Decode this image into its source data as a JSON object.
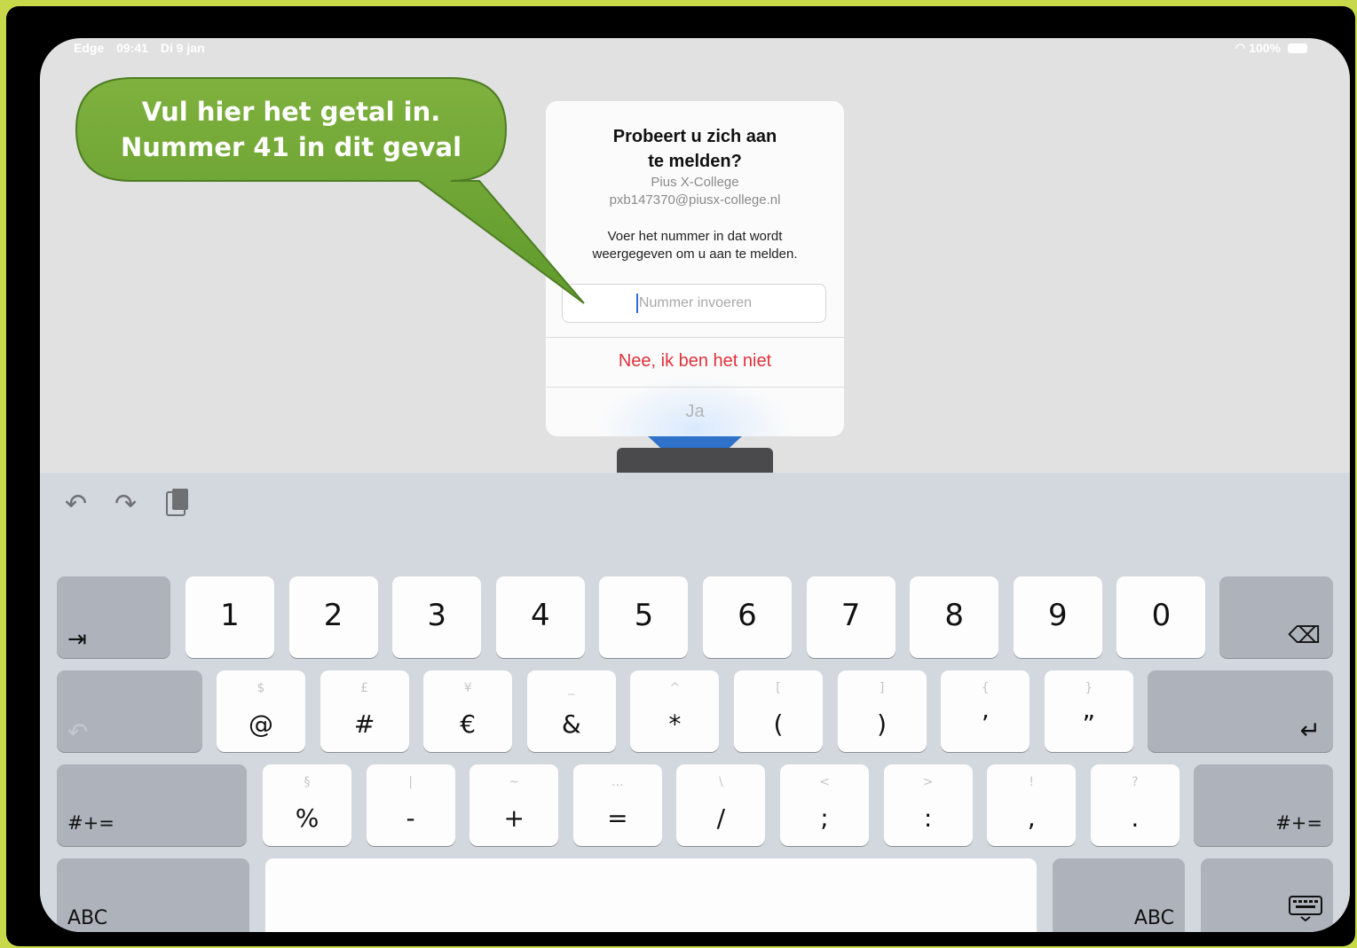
{
  "status": {
    "app": "Edge",
    "time": "09:41",
    "date": "Di 9 jan",
    "battery": "100%"
  },
  "callout": {
    "line1": "Vul hier het getal in.",
    "line2": "Nummer 41 in dit geval"
  },
  "dialog": {
    "title_line1": "Probeert u zich aan",
    "title_line2": "te melden?",
    "org": "Pius X-College",
    "email": "pxb147370@piusx-college.nl",
    "instr_line1": "Voer het nummer in dat wordt",
    "instr_line2": "weergegeven om u aan te melden.",
    "input_placeholder": "Nummer invoeren",
    "deny_label": "Nee, ik ben het niet",
    "confirm_label": "Ja"
  },
  "toolbar": {
    "undo_icon": "undo-icon",
    "redo_icon": "redo-icon",
    "paste_icon": "paste-icon"
  },
  "keyboard": {
    "tab_glyph": "⇥",
    "backspace_glyph": "⌫",
    "undo_glyph": "↶",
    "return_glyph": "↵",
    "digits": [
      "1",
      "2",
      "3",
      "4",
      "5",
      "6",
      "7",
      "8",
      "9",
      "0"
    ],
    "row2": [
      {
        "main": "@",
        "sub": "$"
      },
      {
        "main": "#",
        "sub": "£"
      },
      {
        "main": "€",
        "sub": "¥"
      },
      {
        "main": "&",
        "sub": "_"
      },
      {
        "main": "*",
        "sub": "^"
      },
      {
        "main": "(",
        "sub": "["
      },
      {
        "main": ")",
        "sub": "]"
      },
      {
        "main": "’",
        "sub": "{"
      },
      {
        "main": "”",
        "sub": "}"
      }
    ],
    "row3": [
      {
        "main": "%",
        "sub": "§"
      },
      {
        "main": "-",
        "sub": "|"
      },
      {
        "main": "+",
        "sub": "~"
      },
      {
        "main": "=",
        "sub": "…"
      },
      {
        "main": "/",
        "sub": "\\"
      },
      {
        "main": ";",
        "sub": "<"
      },
      {
        "main": ":",
        "sub": ">"
      },
      {
        "main": ",",
        "sub": "!"
      },
      {
        "main": ".",
        "sub": "?"
      }
    ],
    "symbols_label": "#+=",
    "abc_label": "ABC",
    "hide_keyboard_icon": "keyboard-hide-icon"
  }
}
